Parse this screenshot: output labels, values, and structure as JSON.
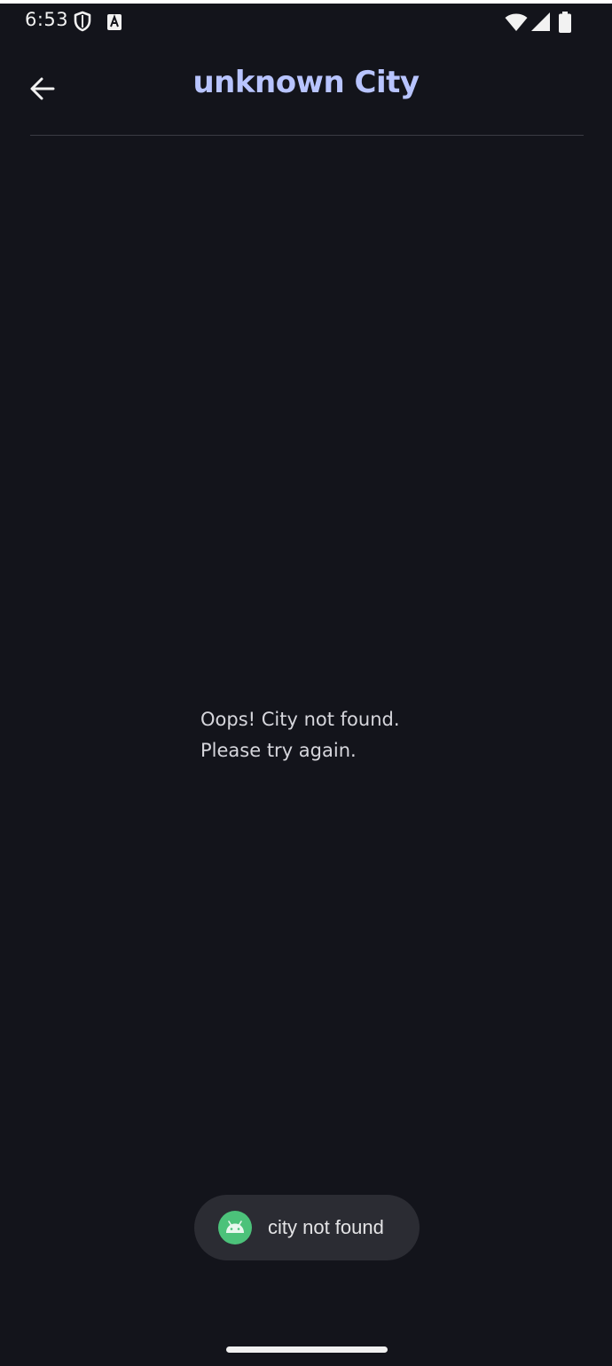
{
  "status_bar": {
    "time": "6:53",
    "icons": [
      "shield-icon",
      "text-a-icon",
      "wifi-icon",
      "cellular-signal-icon",
      "battery-icon"
    ]
  },
  "app_bar": {
    "back_icon": "arrow-back-icon",
    "title": "unknown City"
  },
  "message": {
    "line1": "Oops! City not found.",
    "line2": "Please try again."
  },
  "toast": {
    "icon": "android-icon",
    "text": "city not found"
  },
  "colors": {
    "background": "#13141b",
    "title": "#b8c4ff",
    "toast_background": "#2b2c33",
    "android_green": "#4cc27a"
  }
}
